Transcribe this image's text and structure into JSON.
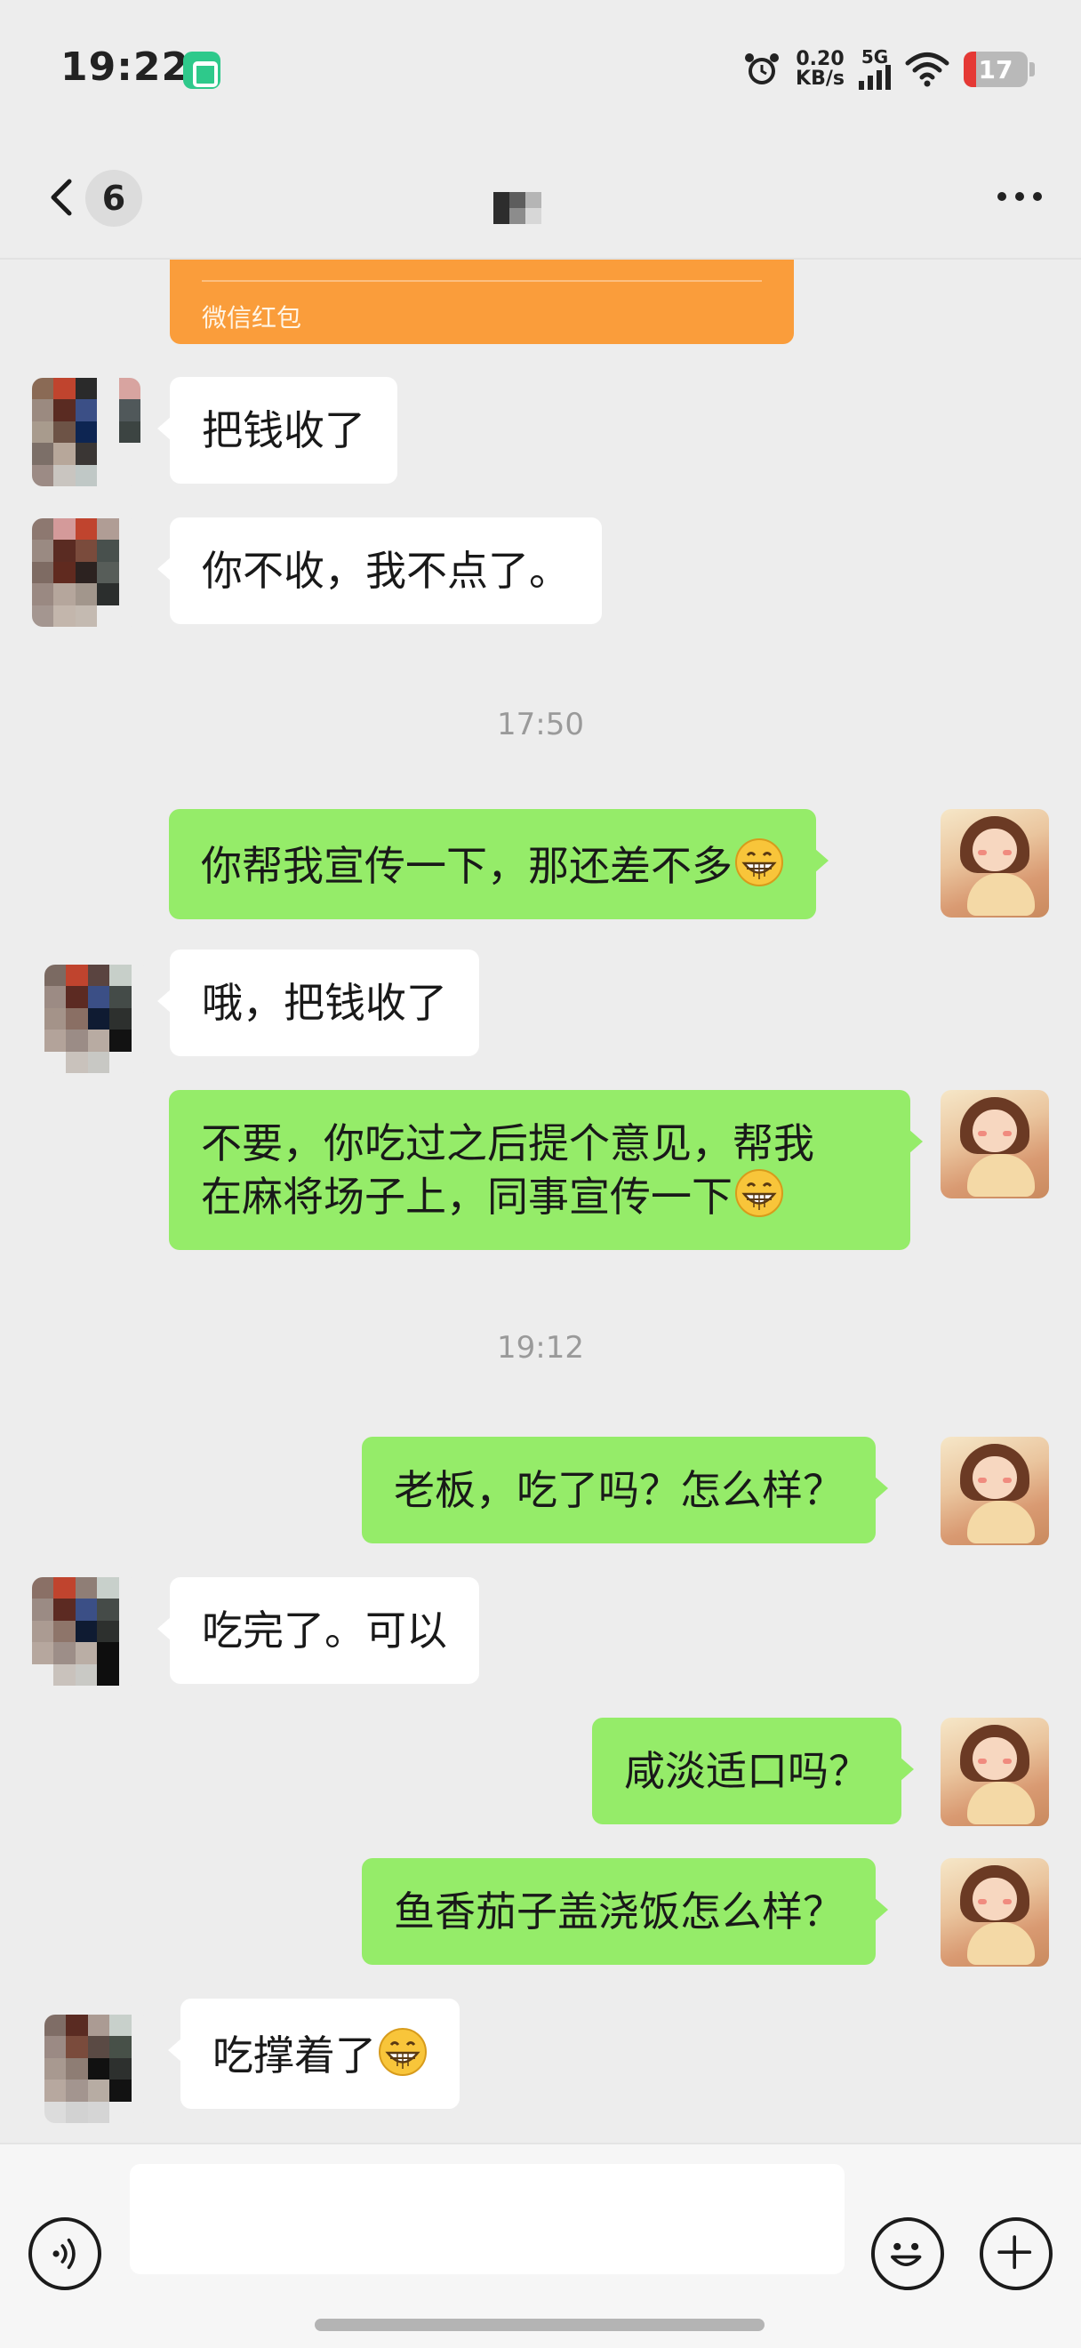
{
  "status_bar": {
    "time": "19:22",
    "net_speed_value": "0.20",
    "net_speed_unit": "KB/s",
    "network_type": "5G",
    "battery_level": "17",
    "icons": [
      "mi-home-icon",
      "alarm-icon",
      "signal-icon",
      "wifi-icon",
      "battery-icon"
    ]
  },
  "nav": {
    "unread_count": "6",
    "icons": [
      "back-chevron-icon",
      "more-icon"
    ]
  },
  "red_packet": {
    "label": "微信红包",
    "color": "#fa9d3b"
  },
  "messages": [
    {
      "dir": "in",
      "text": "把钱收了"
    },
    {
      "dir": "in",
      "text": "你不收，我不点了。"
    },
    {
      "dir": "time",
      "text": "17:50"
    },
    {
      "dir": "out",
      "text": "你帮我宣传一下，那还差不多",
      "emoji": "grin"
    },
    {
      "dir": "in",
      "text": "哦，把钱收了"
    },
    {
      "dir": "out",
      "text": "不要，你吃过之后提个意见，帮我\n在麻将场子上，同事宣传一下",
      "emoji": "grin"
    },
    {
      "dir": "time",
      "text": "19:12"
    },
    {
      "dir": "out",
      "text": "老板，吃了吗？怎么样？"
    },
    {
      "dir": "in",
      "text": "吃完了。可以"
    },
    {
      "dir": "out",
      "text": "咸淡适口吗？"
    },
    {
      "dir": "out",
      "text": "鱼香茄子盖浇饭怎么样？"
    },
    {
      "dir": "in",
      "text": "吃撑着了",
      "emoji": "grin"
    }
  ],
  "input_bar": {
    "placeholder": "",
    "icons": [
      "voice-icon",
      "emoji-icon",
      "plus-icon"
    ]
  },
  "colors": {
    "background": "#ededed",
    "outgoing_bubble": "#95ec69",
    "incoming_bubble": "#ffffff"
  }
}
